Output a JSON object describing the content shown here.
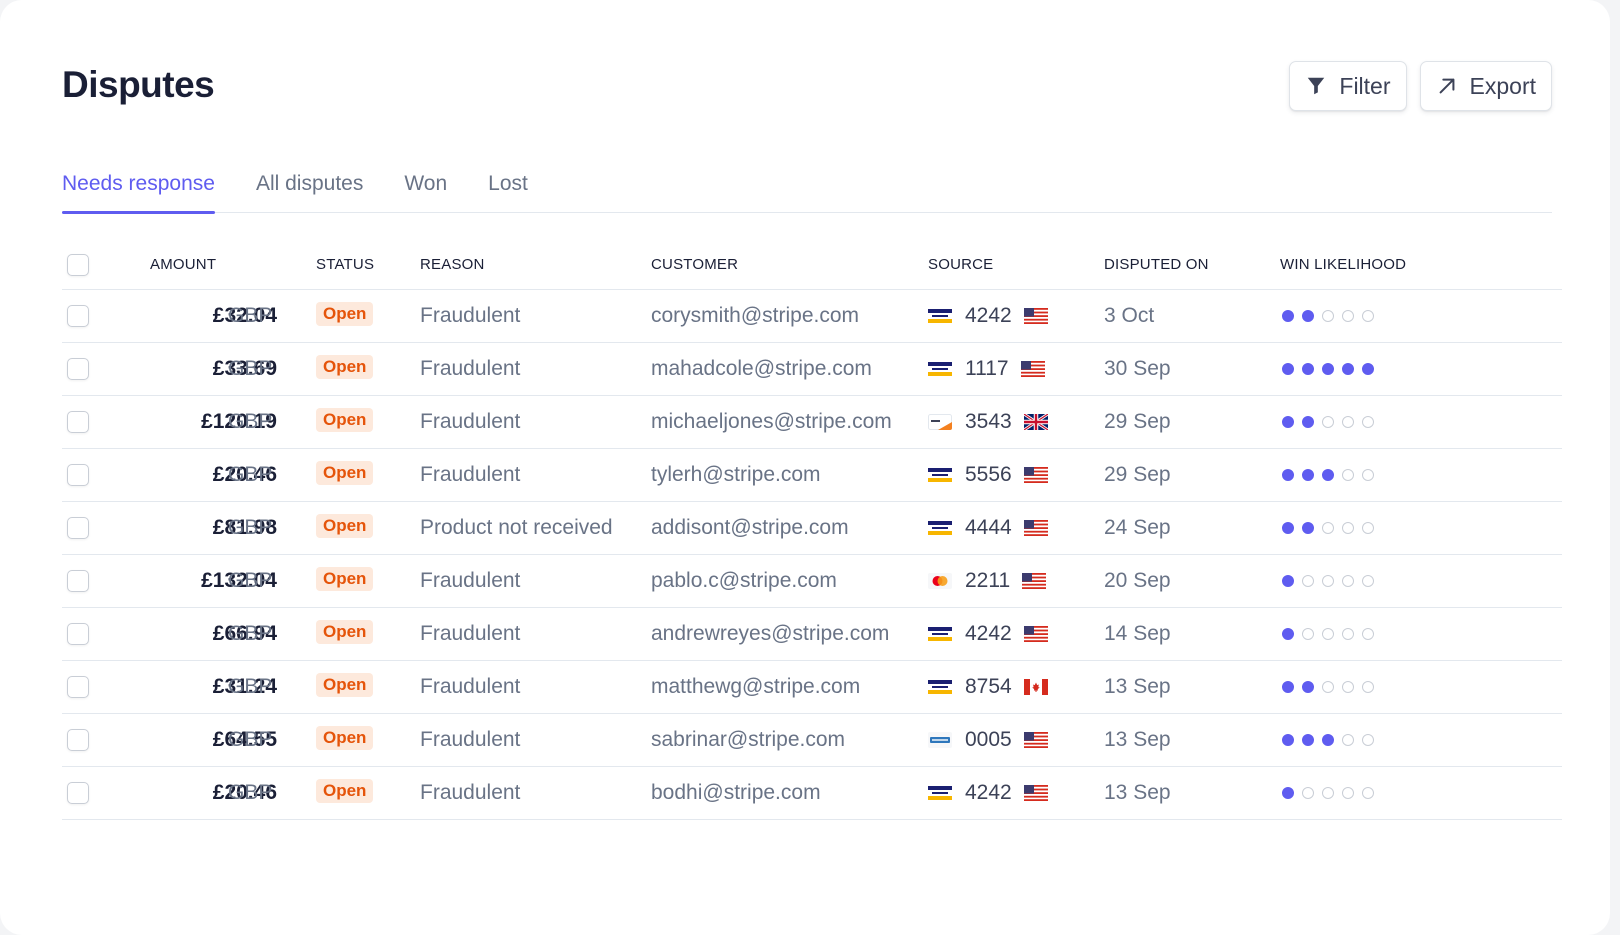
{
  "page": {
    "title": "Disputes"
  },
  "actions": {
    "filter_label": "Filter",
    "export_label": "Export"
  },
  "tabs": [
    {
      "label": "Needs response",
      "active": true
    },
    {
      "label": "All disputes",
      "active": false
    },
    {
      "label": "Won",
      "active": false
    },
    {
      "label": "Lost",
      "active": false
    }
  ],
  "table": {
    "headers": {
      "amount": "AMOUNT",
      "status": "STATUS",
      "reason": "REASON",
      "customer": "CUSTOMER",
      "source": "SOURCE",
      "disputed_on": "DISPUTED ON",
      "win_likelihood": "WIN LIKELIHOOD"
    },
    "win_likelihood_max": 5,
    "rows": [
      {
        "amount": "£32.04",
        "currency": "GBP",
        "status": "Open",
        "reason": "Fraudulent",
        "customer": "corysmith@stripe.com",
        "card_brand": "visa",
        "last4": "4242",
        "country": "us",
        "disputed_on": "3 Oct",
        "win_likelihood": 2
      },
      {
        "amount": "£33.69",
        "currency": "GBP",
        "status": "Open",
        "reason": "Fraudulent",
        "customer": "mahadcole@stripe.com",
        "card_brand": "visa",
        "last4": "1117",
        "country": "us",
        "disputed_on": "30 Sep",
        "win_likelihood": 5
      },
      {
        "amount": "£120.19",
        "currency": "GBP",
        "status": "Open",
        "reason": "Fraudulent",
        "customer": "michaeljones@stripe.com",
        "card_brand": "discover",
        "last4": "3543",
        "country": "gb",
        "disputed_on": "29 Sep",
        "win_likelihood": 2
      },
      {
        "amount": "£20.46",
        "currency": "GBP",
        "status": "Open",
        "reason": "Fraudulent",
        "customer": "tylerh@stripe.com",
        "card_brand": "visa",
        "last4": "5556",
        "country": "us",
        "disputed_on": "29 Sep",
        "win_likelihood": 3
      },
      {
        "amount": "£81.98",
        "currency": "GBP",
        "status": "Open",
        "reason": "Product not received",
        "customer": "addisont@stripe.com",
        "card_brand": "visa",
        "last4": "4444",
        "country": "us",
        "disputed_on": "24 Sep",
        "win_likelihood": 2
      },
      {
        "amount": "£132.04",
        "currency": "GBP",
        "status": "Open",
        "reason": "Fraudulent",
        "customer": "pablo.c@stripe.com",
        "card_brand": "mastercard",
        "last4": "2211",
        "country": "us",
        "disputed_on": "20 Sep",
        "win_likelihood": 1
      },
      {
        "amount": "£66.94",
        "currency": "GBP",
        "status": "Open",
        "reason": "Fraudulent",
        "customer": "andrewreyes@stripe.com",
        "card_brand": "visa",
        "last4": "4242",
        "country": "us",
        "disputed_on": "14 Sep",
        "win_likelihood": 1
      },
      {
        "amount": "£31.24",
        "currency": "GBP",
        "status": "Open",
        "reason": "Fraudulent",
        "customer": "matthewg@stripe.com",
        "card_brand": "visa",
        "last4": "8754",
        "country": "ca",
        "disputed_on": "13 Sep",
        "win_likelihood": 2
      },
      {
        "amount": "£64.55",
        "currency": "GBP",
        "status": "Open",
        "reason": "Fraudulent",
        "customer": "sabrinar@stripe.com",
        "card_brand": "amex",
        "last4": "0005",
        "country": "us",
        "disputed_on": "13 Sep",
        "win_likelihood": 3
      },
      {
        "amount": "£20.46",
        "currency": "GBP",
        "status": "Open",
        "reason": "Fraudulent",
        "customer": "bodhi@stripe.com",
        "card_brand": "visa",
        "last4": "4242",
        "country": "us",
        "disputed_on": "13 Sep",
        "win_likelihood": 1
      }
    ]
  },
  "colors": {
    "accent": "#5f5cf0",
    "open_badge_bg": "#fde9dc",
    "open_badge_text": "#e5540a",
    "heading": "#1a1f36",
    "muted_text": "#697386"
  },
  "icons": {
    "filter": "funnel-icon",
    "export": "arrow-up-right-icon",
    "card_brands": [
      "visa-card-icon",
      "discover-card-icon",
      "mastercard-card-icon",
      "amex-card-icon"
    ],
    "flags": [
      "us-flag-icon",
      "gb-flag-icon",
      "ca-flag-icon"
    ]
  }
}
